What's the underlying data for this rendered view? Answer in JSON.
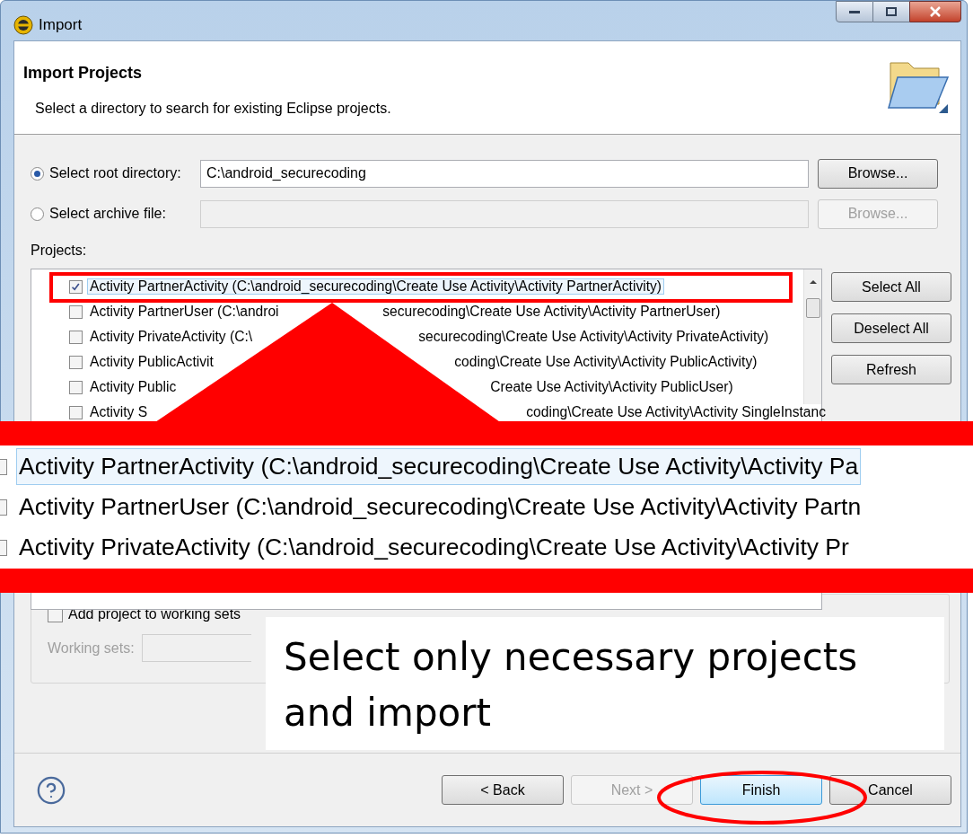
{
  "window": {
    "title": "Import"
  },
  "header": {
    "title": "Import Projects",
    "description": "Select a directory to search for existing Eclipse projects."
  },
  "source_options": [
    {
      "label": "Select root directory:",
      "selected": true,
      "value": "C:\\android_securecoding",
      "button": {
        "label": "Browse...",
        "disabled": false
      }
    },
    {
      "label": "Select archive file:",
      "selected": false,
      "button": {
        "label": "Browse...",
        "disabled": true
      }
    }
  ],
  "projects": {
    "label": "Projects:",
    "rows": [
      {
        "segments": [
          "Activity PartnerActivity (C:\\android_securecoding\\Create Use Activity\\Activity PartnerActivity)"
        ],
        "checked": true,
        "selected": true
      },
      {
        "segments": [
          "Activity PartnerUser (C:\\androi",
          "securecoding\\Create Use Activity\\Activity PartnerUser)"
        ],
        "checked": false,
        "selected": false
      },
      {
        "segments": [
          "Activity PrivateActivity (C:\\",
          "securecoding\\Create Use Activity\\Activity PrivateActivity)"
        ],
        "checked": false,
        "selected": false
      },
      {
        "segments": [
          "Activity PublicActivit",
          "coding\\Create Use Activity\\Activity PublicActivity)"
        ],
        "checked": false,
        "selected": false
      },
      {
        "segments": [
          "Activity Public",
          "Create Use Activity\\Activity PublicUser)"
        ],
        "checked": false,
        "selected": false
      },
      {
        "segments": [
          "Activity S",
          "coding\\Create Use Activity\\Activity SingleInstanc"
        ],
        "checked": false,
        "selected": false
      }
    ],
    "buttons": [
      "Select All",
      "Deselect All",
      "Refresh"
    ]
  },
  "magnified_rows": [
    {
      "text": "Activity PartnerActivity (C:\\android_securecoding\\Create Use Activity\\Activity Pa",
      "selected": true,
      "checked": false
    },
    {
      "text": "Activity PartnerUser (C:\\android_securecoding\\Create Use Activity\\Activity Partn",
      "selected": false,
      "checked": false
    },
    {
      "text": "Activity PrivateActivity (C:\\android_securecoding\\Create Use Activity\\Activity Pr",
      "selected": false,
      "checked": false
    }
  ],
  "working_sets": {
    "checkbox": {
      "label": "Add project to working sets",
      "checked": false
    },
    "label": "Working sets:",
    "disabled": true
  },
  "callout": "Select only necessary projects and import",
  "footer_buttons": [
    {
      "label": "< Back",
      "disabled": false,
      "default": false
    },
    {
      "label": "Next >",
      "disabled": true,
      "default": false
    },
    {
      "label": "Finish",
      "disabled": false,
      "default": true
    },
    {
      "label": "Cancel",
      "disabled": false,
      "default": false
    }
  ]
}
